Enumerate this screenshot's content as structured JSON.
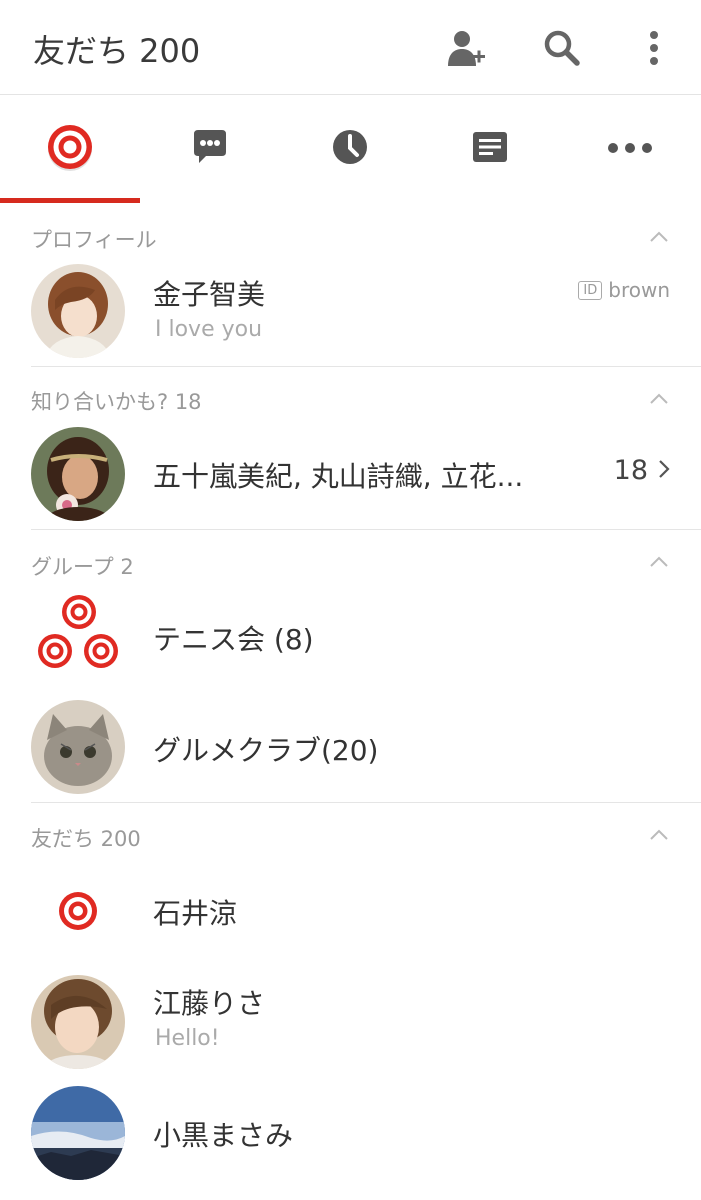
{
  "header": {
    "title": "友だち 200",
    "icons": [
      "add-friend-icon",
      "search-icon",
      "more-vertical-icon"
    ]
  },
  "tabs": [
    {
      "name": "friends",
      "icon": "friends-target-icon",
      "active": true
    },
    {
      "name": "chats",
      "icon": "chat-bubble-icon",
      "active": false
    },
    {
      "name": "timeline",
      "icon": "clock-icon",
      "active": false
    },
    {
      "name": "news",
      "icon": "news-icon",
      "active": false
    },
    {
      "name": "more",
      "icon": "more-horizontal-icon",
      "active": false
    }
  ],
  "colors": {
    "accent": "#d62a1e",
    "section": "#999999",
    "divider": "#e5e5e5"
  },
  "profile": {
    "section_label": "プロフィール",
    "name": "金子智美",
    "status": "I love you",
    "id_badge": "ID",
    "id_value": "brown"
  },
  "suggested": {
    "section_label": "知り合いかも? 18",
    "names": "五十嵐美紀, 丸山詩織, 立花...",
    "count": "18"
  },
  "groups": {
    "section_label": "グループ  2",
    "items": [
      {
        "name": "テニス会 (8)"
      },
      {
        "name": "グルメクラブ(20)"
      }
    ]
  },
  "friends": {
    "section_label": "友だち 200",
    "items": [
      {
        "name": "石井涼",
        "status": ""
      },
      {
        "name": "江藤りさ",
        "status": "Hello!"
      },
      {
        "name": "小黒まさみ",
        "status": ""
      }
    ]
  }
}
